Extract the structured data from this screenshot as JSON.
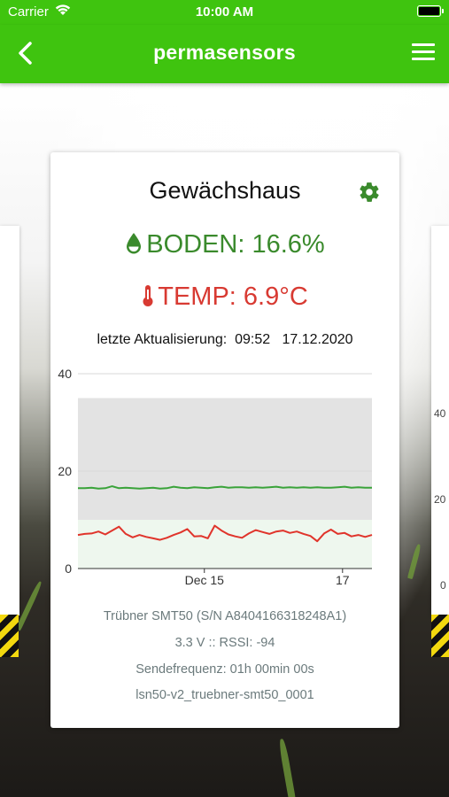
{
  "status_bar": {
    "carrier": "Carrier",
    "time": "10:00 AM"
  },
  "nav": {
    "title": "permasensors",
    "back_icon": "chevron-left-icon",
    "menu_icon": "hamburger-menu-icon"
  },
  "card": {
    "name": "Gewächshaus",
    "soil_text": "BODEN: 16.6%",
    "temp_text": "TEMP: 6.9°C",
    "updated_label": "letzte Aktualisierung:",
    "updated_time": "09:52",
    "updated_date": "17.12.2020",
    "sensor_model": "Trübner SMT50 (S/N A8404166318248A1)",
    "power": "3.3 V :: RSSI: -94",
    "frequency": "Sendefrequenz: 01h 00min 00s",
    "device_id": "lsn50-v2_truebner-smt50_0001",
    "colors": {
      "soil": "#3a8a2c",
      "temp": "#d83a32",
      "accent": "#3fc40f"
    }
  },
  "side_cards": {
    "right_ticks": [
      "40",
      "20",
      "0"
    ]
  },
  "chart_data": {
    "type": "line",
    "x_ticks": [
      "Dec 15",
      "17"
    ],
    "y_ticks": [
      "40",
      "20",
      "0"
    ],
    "ylim": [
      0,
      40
    ],
    "bands": [
      {
        "name": "",
        "from": 10,
        "to": 35,
        "color": "#e3e3e3"
      },
      {
        "name": "",
        "from": 0,
        "to": 10,
        "color": "#eef7ee"
      }
    ],
    "series": [
      {
        "color": "#3aa33a",
        "values": [
          16.5,
          16.5,
          16.6,
          16.4,
          16.5,
          16.9,
          16.5,
          16.6,
          16.5,
          16.4,
          16.5,
          16.6,
          16.4,
          16.5,
          16.8,
          16.6,
          16.5,
          16.7,
          16.6,
          16.5,
          16.7,
          16.8,
          16.6,
          16.7,
          16.7,
          16.6,
          16.7,
          16.6,
          16.7,
          16.8,
          16.6,
          16.7,
          16.6,
          16.7,
          16.6,
          16.7,
          16.6,
          16.6,
          16.7,
          16.8,
          16.6,
          16.7,
          16.6,
          16.6
        ]
      },
      {
        "color": "#e0342b",
        "values": [
          6.9,
          7.1,
          7.2,
          7.6,
          7.0,
          7.8,
          8.6,
          7.1,
          6.4,
          6.9,
          6.5,
          6.2,
          5.9,
          6.3,
          6.9,
          7.4,
          8.1,
          6.6,
          6.7,
          6.2,
          8.8,
          7.8,
          7.0,
          6.6,
          6.3,
          7.2,
          7.9,
          7.5,
          7.1,
          7.6,
          7.8,
          7.3,
          7.6,
          7.1,
          6.7,
          5.6,
          7.2,
          8.0,
          7.1,
          7.3,
          6.6,
          6.9,
          6.5,
          6.9
        ]
      }
    ]
  }
}
